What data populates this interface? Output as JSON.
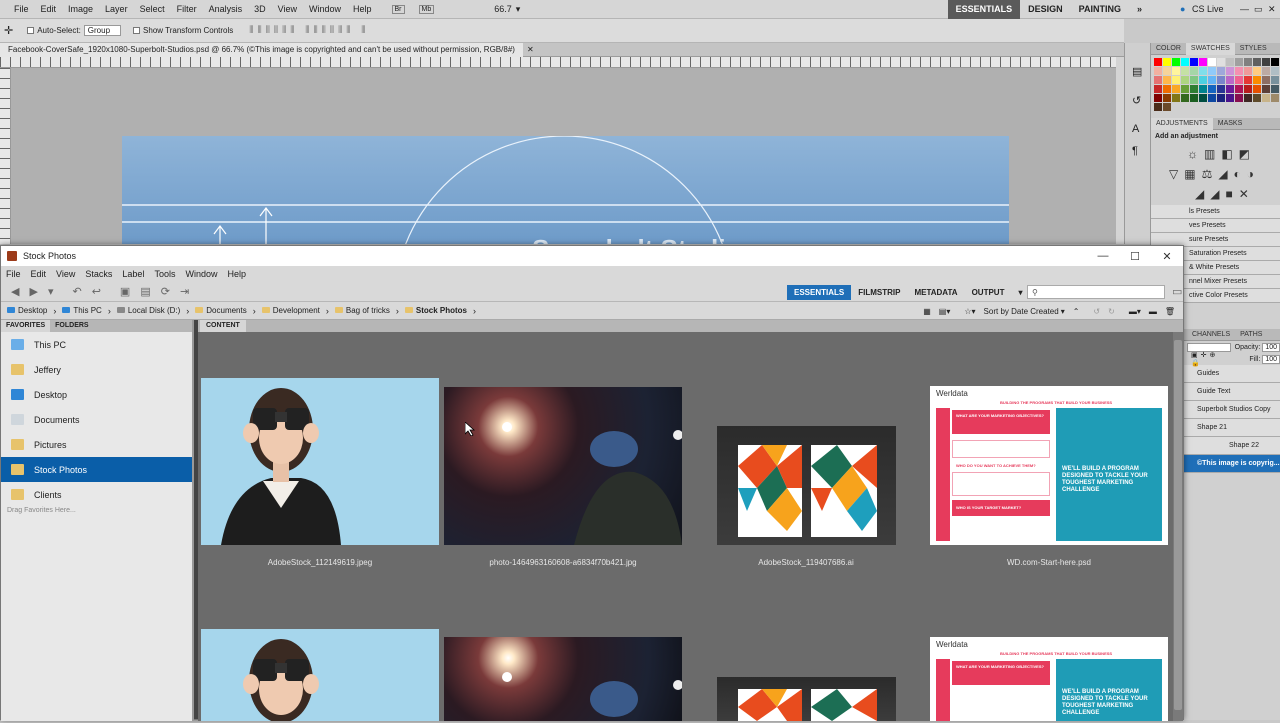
{
  "photoshop": {
    "menu": [
      "File",
      "Edit",
      "Image",
      "Layer",
      "Select",
      "Filter",
      "Analysis",
      "3D",
      "View",
      "Window",
      "Help"
    ],
    "zoom": "66.7",
    "workspaces": [
      "ESSENTIALS",
      "DESIGN",
      "PAINTING"
    ],
    "cs_live": "CS Live",
    "options": {
      "auto_select_label": "Auto-Select:",
      "auto_select_value": "Group",
      "transform_label": "Show Transform Controls"
    },
    "document_tab": "Facebook-CoverSafe_1920x1080-Superbolt-Studios.psd @ 66.7% (©This image is copyrighted and can't be used without permission, RGB/8#)",
    "canvas_text": "Superbolt Studios",
    "panels": {
      "color_tabs": [
        "COLOR",
        "SWATCHES",
        "STYLES"
      ],
      "adjust_tabs": [
        "ADJUSTMENTS",
        "MASKS"
      ],
      "add_adjustment": "Add an adjustment",
      "presets": [
        "ls Presets",
        "ves Presets",
        "sure Presets",
        "Saturation Presets",
        "& White Presets",
        "nnel Mixer Presets",
        "ctive Color Presets"
      ],
      "layers_tabs": [
        "CHANNELS",
        "PATHS"
      ],
      "opacity_label": "Opacity:",
      "opacity_value": "100",
      "fill_label": "Fill:",
      "fill_value": "100",
      "layers": [
        "Guides",
        "Guide Text",
        "Superbolt Studios Copy",
        "Shape 21",
        "Shape 22",
        "©This image is copyrig..."
      ]
    },
    "swatch_colors": [
      "#ff0000",
      "#ffff00",
      "#00ff00",
      "#00ffff",
      "#0000ff",
      "#ff00ff",
      "#ffffff",
      "#e0e0e0",
      "#c0c0c0",
      "#a0a0a0",
      "#808080",
      "#606060",
      "#404040",
      "#000000",
      "#f2b0a0",
      "#f6d49b",
      "#fff59d",
      "#c5e1a5",
      "#a5d6a7",
      "#80deea",
      "#90caf9",
      "#9fa8da",
      "#ce93d8",
      "#f48fb1",
      "#ef9a9a",
      "#ffcc80",
      "#bcaaa4",
      "#b0bec5",
      "#e57373",
      "#ffb74d",
      "#fff176",
      "#aed581",
      "#81c784",
      "#4dd0e1",
      "#64b5f6",
      "#7986cb",
      "#ba68c8",
      "#f06292",
      "#e53935",
      "#fb8c00",
      "#8d6e63",
      "#78909c",
      "#c62828",
      "#ef6c00",
      "#f9a825",
      "#689f38",
      "#2e7d32",
      "#00838f",
      "#1565c0",
      "#283593",
      "#6a1b9a",
      "#ad1457",
      "#b71c1c",
      "#e65100",
      "#5d4037",
      "#455a64",
      "#7f0000",
      "#8a3a00",
      "#827717",
      "#33691e",
      "#1b5e20",
      "#004d40",
      "#0d47a1",
      "#1a237e",
      "#4a148c",
      "#880e4f",
      "#3e2723",
      "#5d4a2a",
      "#c8b48a",
      "#9e8a6a",
      "#4a2c1a",
      "#6b4a2a"
    ]
  },
  "bridge": {
    "title": "Stock Photos",
    "menu": [
      "File",
      "Edit",
      "View",
      "Stacks",
      "Label",
      "Tools",
      "Window",
      "Help"
    ],
    "workspaces": [
      "ESSENTIALS",
      "FILMSTRIP",
      "METADATA",
      "OUTPUT"
    ],
    "search_placeholder": "",
    "path": [
      "Desktop",
      "This PC",
      "Local Disk (D:)",
      "Documents",
      "Development",
      "Bag of tricks",
      "Stock Photos"
    ],
    "sort_label": "Sort by Date Created",
    "left_tabs": [
      "FAVORITES",
      "FOLDERS"
    ],
    "favorites": [
      "This PC",
      "Jeffery",
      "Desktop",
      "Documents",
      "Pictures",
      "Stock Photos",
      "Clients"
    ],
    "drag_hint": "Drag Favorites Here...",
    "content_tab": "CONTENT",
    "files": [
      "AdobeStock_112149619.jpeg",
      "photo-1464963160608-a6834f70b421.jpg",
      "AdobeStock_119407686.ai",
      "WD.com-Start-here.psd"
    ],
    "wd_text": {
      "logo": "Werldata",
      "headline": "BUILDING THE PROGRAMS THAT BUILD YOUR BUSINESS",
      "tagline": "WE'LL BUILD A PROGRAM DESIGNED TO TACKLE YOUR TOUGHEST MARKETING CHALLENGE",
      "q1": "WHAT ARE YOUR MARKETING OBJECTIVES?",
      "q2": "WHO DO YOU WANT TO ACHIEVE THEM?",
      "q3": "WHO IS YOUR TARGET MARKET?"
    }
  }
}
